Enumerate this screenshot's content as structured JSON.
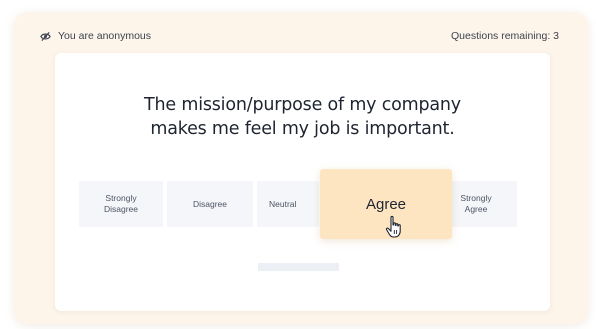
{
  "header": {
    "anonymous_label": "You are anonymous",
    "anonymous_icon": "eye-slash-icon",
    "questions_remaining": "Questions remaining: 3"
  },
  "question": {
    "line1": "The mission/purpose of my company",
    "line2": "makes me feel my job is important."
  },
  "options": {
    "strongly_disagree": [
      "Strongly",
      "Disagree"
    ],
    "disagree": "Disagree",
    "neutral": "Neutral",
    "agree": "Agree",
    "strongly_agree": [
      "Strongly",
      "Agree"
    ]
  },
  "selected_option": "Agree",
  "cursor_icon": "hand-pointer-icon",
  "progress": {
    "fraction": 0
  },
  "colors": {
    "outer_background": "#fdf4ea",
    "selected_option": "#fde5c2",
    "option_background": "#f4f6f9",
    "text_dark": "#1e2430"
  }
}
